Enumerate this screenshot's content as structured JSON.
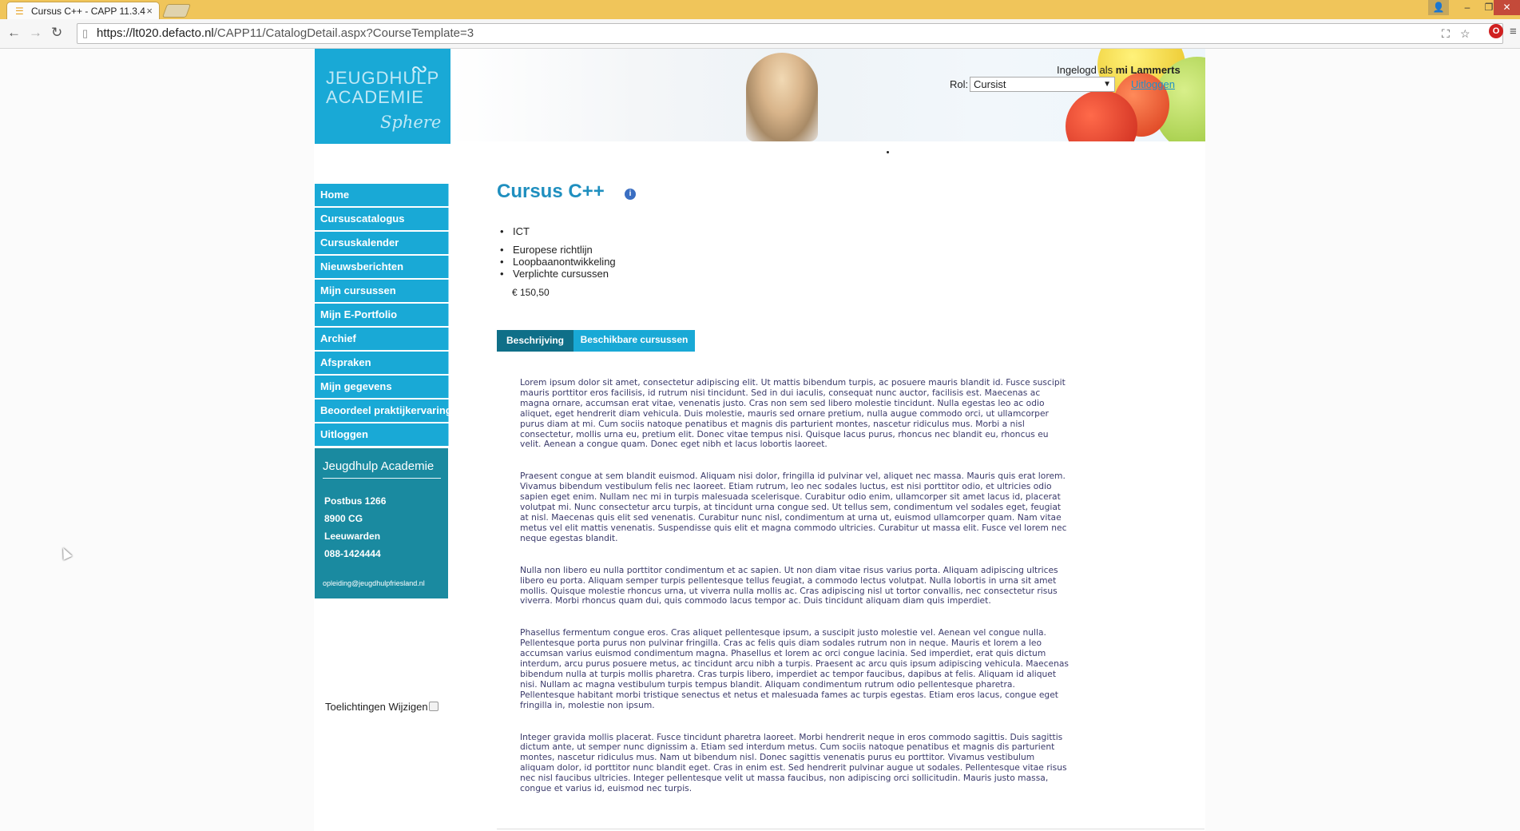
{
  "browser": {
    "tab_title": "Cursus C++ - CAPP 11.3.4",
    "tab_close": "×",
    "url_domain": "https://lt020.defacto.nl",
    "url_path": "/CAPP11/CatalogDetail.aspx?CourseTemplate=3"
  },
  "header": {
    "logo_line1": "JEUGDHULP",
    "logo_line2": "ACADEMIE",
    "logo_line3": "Sphere",
    "login_prefix": "Ingelogd als",
    "login_user": "mi Lammerts",
    "role_label": "Rol:",
    "role_value": "Cursist",
    "logout_link": "Uitloggen"
  },
  "sidebar": {
    "items": [
      {
        "label": "Home"
      },
      {
        "label": "Cursuscatalogus"
      },
      {
        "label": "Cursuskalender"
      },
      {
        "label": "Nieuwsberichten"
      },
      {
        "label": "Mijn cursussen"
      },
      {
        "label": "Mijn E-Portfolio"
      },
      {
        "label": "Archief"
      },
      {
        "label": "Afspraken"
      },
      {
        "label": "Mijn gegevens"
      },
      {
        "label": "Beoordeel praktijkervaring"
      },
      {
        "label": "Uitloggen"
      }
    ],
    "contact": {
      "title": "Jeugdhulp Academie",
      "line1": "Postbus 1266",
      "line2": "8900 CG",
      "line3": "Leeuwarden",
      "phone": "088-1424444",
      "email": "opleiding@jeugdhulpfriesland.nl"
    },
    "toelichtingen_label": "Toelichtingen Wijzigen"
  },
  "course": {
    "title": "Cursus C++",
    "categories_primary": [
      "ICT"
    ],
    "categories_secondary": [
      "Europese richtlijn",
      "Loopbaanontwikkeling",
      "Verplichte cursussen"
    ],
    "price": "€ 150,50",
    "tabs": {
      "description": "Beschrijving",
      "available": "Beschikbare cursussen"
    },
    "paragraphs": [
      "Lorem ipsum dolor sit amet, consectetur adipiscing elit. Ut mattis bibendum turpis, ac posuere mauris blandit id. Fusce suscipit mauris porttitor eros facilisis, id rutrum nisi tincidunt. Sed in dui iaculis, consequat nunc auctor, facilisis est. Maecenas ac magna ornare, accumsan erat vitae, venenatis justo. Cras non sem sed libero molestie tincidunt. Nulla egestas leo ac odio aliquet, eget hendrerit diam vehicula. Duis molestie, mauris sed ornare pretium, nulla augue commodo orci, ut ullamcorper purus diam at mi. Cum sociis natoque penatibus et magnis dis parturient montes, nascetur ridiculus mus. Morbi a nisl consectetur, mollis urna eu, pretium elit. Donec vitae tempus nisi. Quisque lacus purus, rhoncus nec blandit eu, rhoncus eu velit. Aenean a congue quam. Donec eget nibh et lacus lobortis laoreet.",
      "Praesent congue at sem blandit euismod. Aliquam nisi dolor, fringilla id pulvinar vel, aliquet nec massa. Mauris quis erat lorem. Vivamus bibendum vestibulum felis nec laoreet. Etiam rutrum, leo nec sodales luctus, est nisi porttitor odio, et ultricies odio sapien eget enim. Nullam nec mi in turpis malesuada scelerisque. Curabitur odio enim, ullamcorper sit amet lacus id, placerat volutpat mi. Nunc consectetur arcu turpis, at tincidunt urna congue sed. Ut tellus sem, condimentum vel sodales eget, feugiat at nisl. Maecenas quis elit sed venenatis. Curabitur nunc nisl, condimentum at urna ut, euismod ullamcorper quam. Nam vitae metus vel elit mattis venenatis. Suspendisse quis elit et magna commodo ultricies. Curabitur ut massa elit. Fusce vel lorem nec neque egestas blandit.",
      "Nulla non libero eu nulla porttitor condimentum et ac sapien. Ut non diam vitae risus varius porta. Aliquam adipiscing ultrices libero eu porta. Aliquam semper turpis pellentesque tellus feugiat, a commodo lectus volutpat. Nulla lobortis in urna sit amet mollis. Quisque molestie rhoncus urna, ut viverra nulla mollis ac. Cras adipiscing nisl ut tortor convallis, nec consectetur risus viverra. Morbi rhoncus quam dui, quis commodo lacus tempor ac. Duis tincidunt aliquam diam quis imperdiet.",
      "Phasellus fermentum congue eros. Cras aliquet pellentesque ipsum, a suscipit justo molestie vel. Aenean vel congue nulla. Pellentesque porta purus non pulvinar fringilla. Cras ac felis quis diam sodales rutrum non in neque. Mauris et lorem a leo accumsan varius euismod condimentum magna. Phasellus et lorem ac orci congue lacinia. Sed imperdiet, erat quis dictum interdum, arcu purus posuere metus, ac tincidunt arcu nibh a turpis. Praesent ac arcu quis ipsum adipiscing vehicula. Maecenas bibendum nulla at turpis mollis pharetra. Cras turpis libero, imperdiet ac tempor faucibus, dapibus at felis. Aliquam id aliquet nisi. Nullam ac magna vestibulum turpis tempus blandit. Aliquam condimentum rutrum odio pellentesque pharetra. Pellentesque habitant morbi tristique senectus et netus et malesuada fames ac turpis egestas. Etiam eros lacus, congue eget fringilla in, molestie non ipsum.",
      "Integer gravida mollis placerat. Fusce tincidunt pharetra laoreet. Morbi hendrerit neque in eros commodo sagittis. Duis sagittis dictum ante, ut semper nunc dignissim a. Etiam sed interdum metus. Cum sociis natoque penatibus et magnis dis parturient montes, nascetur ridiculus mus. Nam ut bibendum nisl. Donec sagittis venenatis purus eu porttitor. Vivamus vestibulum aliquam dolor, id porttitor nunc blandit eget. Cras in enim est. Sed hendrerit pulvinar augue ut sodales. Pellentesque vitae risus nec nisl faucibus ultricies. Integer pellentesque velit ut massa faucibus, non adipiscing orci sollicitudin. Mauris justo massa, congue et varius id, euismod nec turpis."
    ]
  },
  "colors": {
    "nav_blue": "#19a9d6",
    "tab_active": "#0f6f88",
    "contact_bg": "#1a8aa0",
    "title_blue": "#1f8fbf"
  }
}
